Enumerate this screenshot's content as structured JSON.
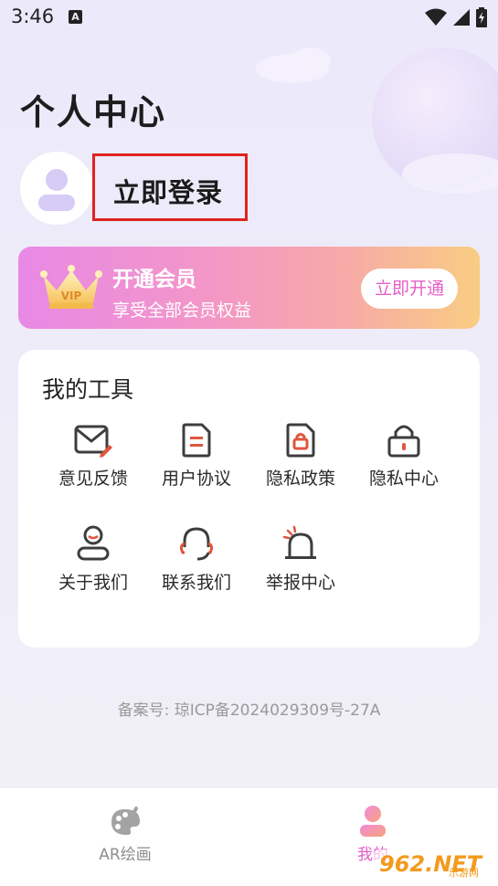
{
  "status_bar": {
    "time": "3:46",
    "notification_letter": "A",
    "icons": [
      "wifi-icon",
      "signal-icon",
      "battery-charging-icon"
    ]
  },
  "header": {
    "title": "个人中心"
  },
  "profile": {
    "login_label": "立即登录"
  },
  "vip": {
    "title": "开通会员",
    "subtitle": "享受全部会员权益",
    "button_label": "立即开通",
    "badge": "VIP"
  },
  "tools": {
    "title": "我的工具",
    "items": [
      {
        "label": "意见反馈",
        "icon": "feedback-mail-icon"
      },
      {
        "label": "用户协议",
        "icon": "document-icon"
      },
      {
        "label": "隐私政策",
        "icon": "privacy-lock-document-icon"
      },
      {
        "label": "隐私中心",
        "icon": "lock-icon"
      },
      {
        "label": "关于我们",
        "icon": "user-icon"
      },
      {
        "label": "联系我们",
        "icon": "headset-icon"
      },
      {
        "label": "举报中心",
        "icon": "alarm-icon"
      }
    ]
  },
  "footer": {
    "icp": "备案号: 琼ICP备2024029309号-27A"
  },
  "bottom_nav": {
    "items": [
      {
        "label": "AR绘画",
        "icon": "palette-icon",
        "active": false
      },
      {
        "label": "我的",
        "icon": "profile-icon",
        "active": true
      }
    ]
  },
  "watermark": {
    "text": "962.NET",
    "subtext": "乐游网"
  },
  "colors": {
    "accent": "#e55fc8",
    "login_highlight": "#e0231f",
    "icon_red": "#e0553e"
  }
}
